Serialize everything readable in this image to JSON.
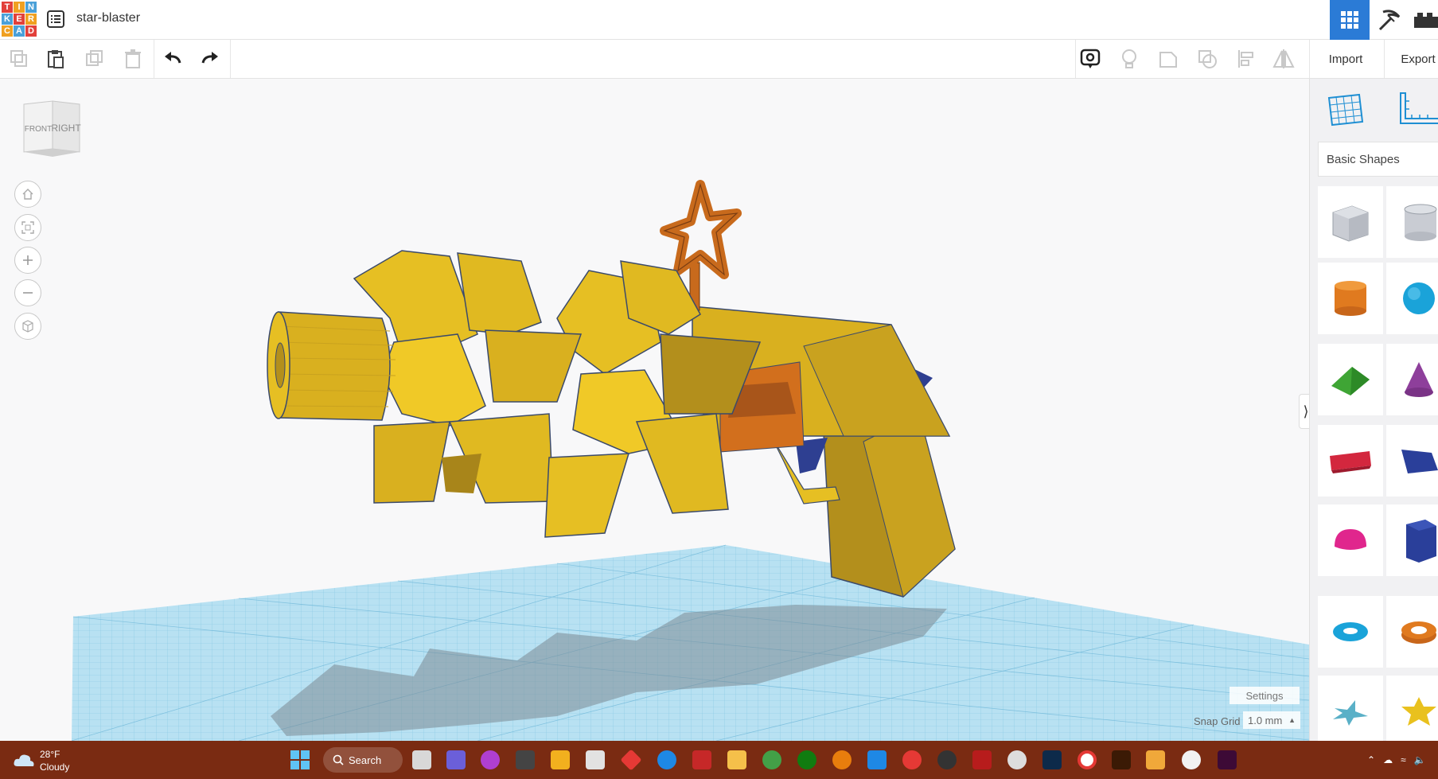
{
  "titlebar": {
    "logo_letters": [
      "T",
      "I",
      "N",
      "K",
      "E",
      "R",
      "C",
      "A",
      "D"
    ],
    "doc_title": "star-blaster"
  },
  "toolbar": {
    "import_label": "Import",
    "export_label": "Export"
  },
  "viewport": {
    "viewcube": {
      "front": "FRONT",
      "right": "RIGHT"
    },
    "settings_label": "Settings",
    "snap_grid_label": "Snap Grid",
    "snap_grid_value": "1.0 mm"
  },
  "panel": {
    "category": "Basic Shapes",
    "shapes": [
      {
        "name": "box-striped",
        "color": "#c9ccd3"
      },
      {
        "name": "cylinder-striped",
        "color": "#c9ccd3"
      },
      {
        "name": "cylinder",
        "color": "#e07a1f"
      },
      {
        "name": "sphere",
        "color": "#1aa3d9"
      },
      {
        "name": "roof",
        "color": "#3fa535"
      },
      {
        "name": "cone",
        "color": "#8e3f9b"
      },
      {
        "name": "text",
        "color": "#d3273e"
      },
      {
        "name": "wedge",
        "color": "#2a3f9a"
      },
      {
        "name": "half-sphere",
        "color": "#e0268d"
      },
      {
        "name": "polygon",
        "color": "#2a3f9a"
      },
      {
        "name": "torus",
        "color": "#1aa3d9"
      },
      {
        "name": "tube",
        "color": "#e07a1f"
      },
      {
        "name": "star",
        "color": "#5ab0c7"
      },
      {
        "name": "star-yellow",
        "color": "#e9c11e"
      }
    ]
  },
  "taskbar": {
    "weather_temp": "28°F",
    "weather_condition": "Cloudy",
    "search_label": "Search"
  },
  "colors": {
    "accent": "#2b7bd6",
    "model_yellow": "#e6bf23",
    "model_orange": "#d26f1d",
    "model_blue": "#2e3f91",
    "grid_blue": "#9fd3ea",
    "taskbar": "#7a2b12"
  }
}
